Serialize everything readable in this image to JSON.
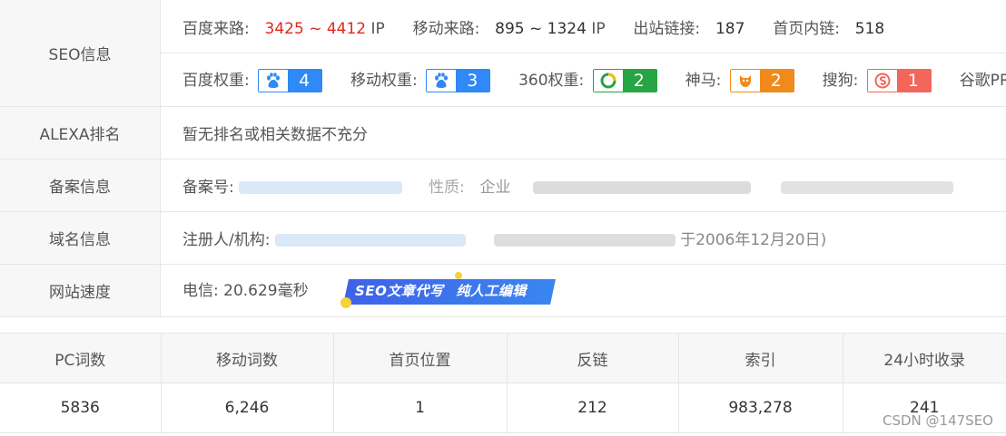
{
  "seo": {
    "label": "SEO信息",
    "baidu_traffic_label": "百度来路:",
    "baidu_traffic_value": "3425 ~ 4412",
    "ip_unit": "IP",
    "mobile_traffic_label": "移动来路:",
    "mobile_traffic_value": "895 ~ 1324",
    "outbound_label": "出站链接:",
    "outbound_value": "187",
    "internal_label": "首页内链:",
    "internal_value": "518",
    "baidu_weight_label": "百度权重:",
    "baidu_weight": "4",
    "mobile_weight_label": "移动权重:",
    "mobile_weight": "3",
    "weight_360_label": "360权重:",
    "weight_360": "2",
    "shenma_label": "神马:",
    "shenma": "2",
    "sogou_label": "搜狗:",
    "sogou": "1",
    "google_pr_label": "谷歌PR:"
  },
  "alexa": {
    "label": "ALEXA排名",
    "value": "暂无排名或相关数据不充分"
  },
  "icp": {
    "label": "备案信息",
    "number_label": "备案号:",
    "nature_label": "性质:",
    "nature_value": "企业"
  },
  "domain": {
    "label": "域名信息",
    "registrant_label": "注册人/机构:",
    "date_fragment": "于2006年12月20日)"
  },
  "speed": {
    "label": "网站速度",
    "value": "电信: 20.629毫秒",
    "promo_text_1": "SEO文章代写",
    "promo_text_2": "纯人工编辑"
  },
  "stats": {
    "headers": [
      "PC词数",
      "移动词数",
      "首页位置",
      "反链",
      "索引",
      "24小时收录"
    ],
    "values": [
      "5836",
      "6,246",
      "1",
      "212",
      "983,278",
      "241"
    ]
  },
  "watermark": "CSDN @147SEO",
  "colors": {
    "red": "#e0281d",
    "baidu": "#2f89f6",
    "c360": "#27a443",
    "shenma": "#f08a1c",
    "sogou": "#f2665b"
  }
}
